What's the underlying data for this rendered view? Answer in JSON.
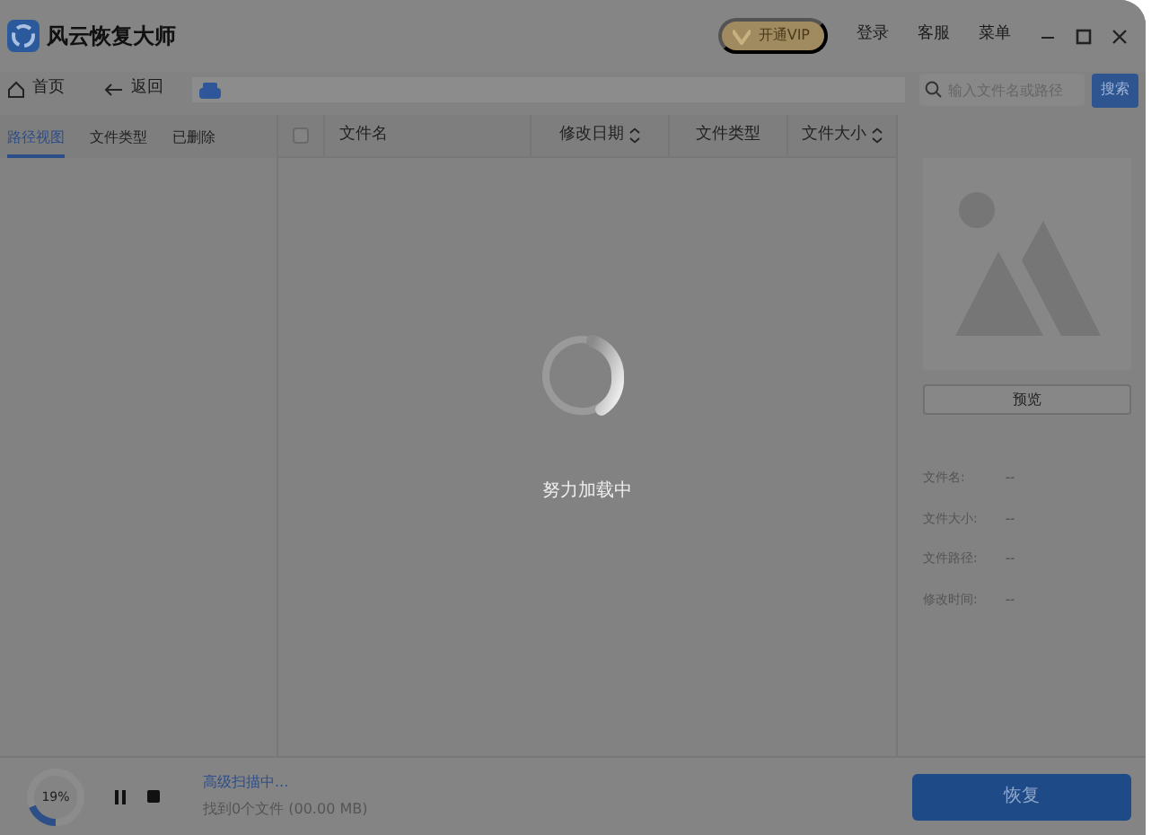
{
  "app": {
    "title": "风云恢复大师"
  },
  "title_bar": {
    "vip": "开通VIP",
    "links": [
      "登录",
      "客服",
      "菜单"
    ]
  },
  "toolbar": {
    "home": "首页",
    "back": "返回",
    "search": {
      "placeholder": "输入文件名或路径"
    },
    "search_button": "搜索"
  },
  "view_tabs": [
    {
      "label": "路径视图",
      "selected": true
    },
    {
      "label": "文件类型",
      "selected": false
    },
    {
      "label": "已删除",
      "selected": false
    }
  ],
  "table": {
    "select_all": {
      "checked": false
    },
    "columns": [
      {
        "label": "文件名",
        "sortable": false
      },
      {
        "label": "修改日期",
        "sortable": true
      },
      {
        "label": "文件类型",
        "sortable": false
      },
      {
        "label": "文件大小",
        "sortable": true
      }
    ]
  },
  "loading": {
    "text": "努力加载中"
  },
  "preview": {
    "button": "预览",
    "fields": [
      {
        "label": "文件名:",
        "value": "--"
      },
      {
        "label": "文件大小:",
        "value": "--"
      },
      {
        "label": "文件路径:",
        "value": "--"
      },
      {
        "label": "修改时间:",
        "value": "--"
      }
    ]
  },
  "status": {
    "progress": {
      "label": "19%",
      "level": 0.19
    },
    "scan_status": "高级扫描中...",
    "found": "找到0个文件 (00.00 MB)"
  },
  "recover_button": "恢复"
}
